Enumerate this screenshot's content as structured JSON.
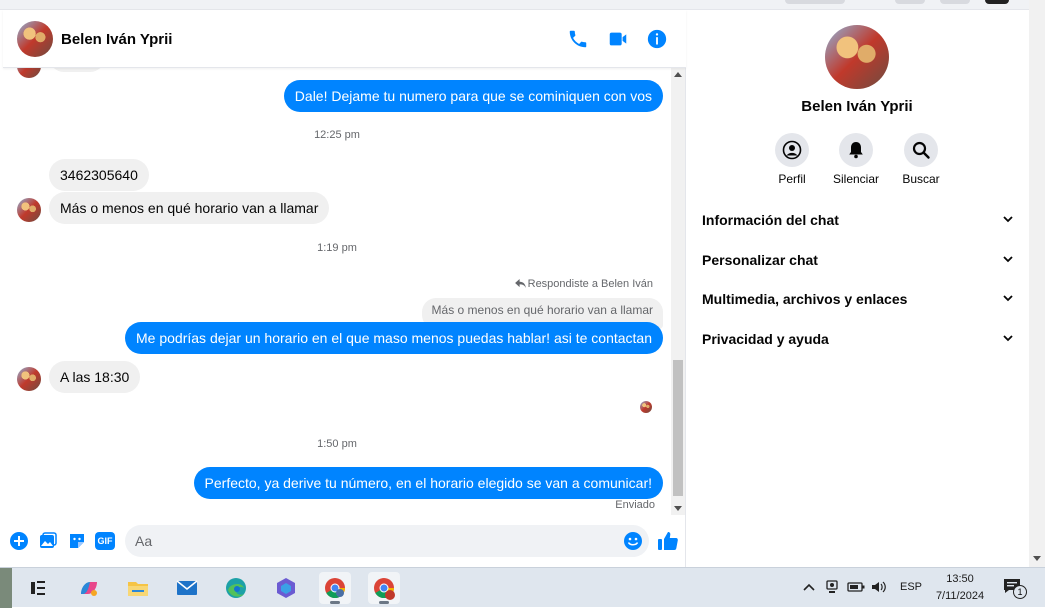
{
  "contact": {
    "name": "Belen Iván Yprii"
  },
  "colors": {
    "accent": "#0084ff",
    "incoming_bubble": "#f0f0f0",
    "muted_text": "#65676b"
  },
  "header_icons": [
    "phone-icon",
    "video-camera-icon",
    "info-icon"
  ],
  "messages": [
    {
      "direction": "out",
      "text": "Dale! Dejame tu numero para que se cominiquen con vos"
    },
    {
      "type": "timestamp",
      "text": "12:25 pm"
    },
    {
      "direction": "in",
      "text": "3462305640"
    },
    {
      "direction": "in",
      "text": "Más o menos en qué horario van a llamar"
    },
    {
      "type": "timestamp",
      "text": "1:19 pm"
    },
    {
      "type": "reply_note",
      "text": "Respondiste a Belen Iván"
    },
    {
      "type": "quoted",
      "text": "Más o menos en qué horario van a llamar"
    },
    {
      "direction": "out",
      "text": "Me podrías dejar un horario en el que  maso menos puedas hablar! asi te contactan"
    },
    {
      "direction": "in",
      "text": "A las 18:30"
    },
    {
      "type": "timestamp",
      "text": "1:50 pm"
    },
    {
      "direction": "out",
      "text": "Perfecto, ya derive tu número, en el horario elegido se van a comunicar!"
    },
    {
      "type": "status",
      "text": "Enviado"
    }
  ],
  "composer": {
    "placeholder": "Aa",
    "icons": [
      "add-icon",
      "image-icon",
      "sticker-icon",
      "gif-icon",
      "emoji-icon",
      "like-icon"
    ],
    "gif_label": "GIF"
  },
  "info_panel": {
    "name": "Belen Iván Yprii",
    "actions": [
      {
        "label": "Perfil",
        "icon": "profile-icon"
      },
      {
        "label": "Silenciar",
        "icon": "bell-icon"
      },
      {
        "label": "Buscar",
        "icon": "search-icon"
      }
    ],
    "sections": [
      "Información del chat",
      "Personalizar chat",
      "Multimedia, archivos y enlaces",
      "Privacidad y ayuda"
    ]
  },
  "taskbar": {
    "apps": [
      "task-view-icon",
      "copilot-icon",
      "file-explorer-icon",
      "mail-icon",
      "edge-icon",
      "copilot-365-icon",
      "chrome-icon",
      "chrome-profile-icon"
    ],
    "language": "ESP",
    "time": "13:50",
    "date": "7/11/2024",
    "notification_count": "1"
  }
}
